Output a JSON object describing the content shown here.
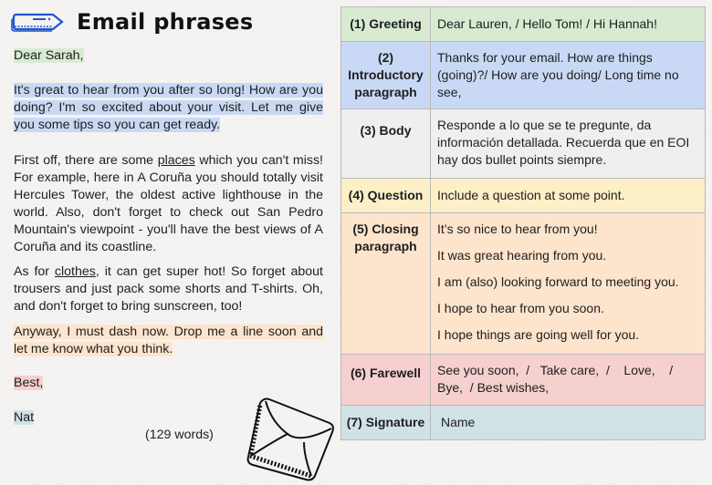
{
  "header": {
    "icon": "tag-label-icon",
    "title": "Email phrases"
  },
  "email": {
    "greeting": "Dear Sarah,",
    "intro": "It's great to hear from you after so long! How are you doing? I'm so excited about your visit. Let me give you some tips so you can get ready.",
    "body1_before": "First off, there are some ",
    "body1_link": "places",
    "body1_after": " which you can't miss! For example, here in A Coruña you should totally visit Hercules Tower, the oldest active lighthouse in the world. Also, don't forget to check out San Pedro Mountain's viewpoint - you'll have the best views of A Coruña and its coastline.",
    "body2_before": "As for ",
    "body2_link": "clothes",
    "body2_after": ", it can get super hot! So forget about trousers and just pack some shorts and T-shirts. Oh, and don't forget to bring sunscreen, too!",
    "closing": "Anyway, I must dash now. Drop me a line soon and let me know what you think.",
    "farewell": "Best,",
    "signature": "Nat",
    "word_count": "(129 words)"
  },
  "decoration": {
    "envelope_icon": "envelope-icon"
  },
  "table": {
    "rows": [
      {
        "label": "(1) Greeting",
        "content": "Dear Lauren,  / Hello Tom!  / Hi Hannah!",
        "color": "#d8ebd2"
      },
      {
        "label_lines": [
          "(2)",
          "Introductory",
          "paragraph"
        ],
        "content": "Thanks for your email. How are things (going)?/ How are you doing/ Long time no see,",
        "color": "#c9d9f5"
      },
      {
        "label": "(3) Body",
        "content": "Responde a lo que se te pregunte, da información detallada. Recuerda que en EOI hay dos bullet points siempre.",
        "color": "#efefef"
      },
      {
        "label": "(4) Question",
        "content": "Include a question at some point.",
        "color": "#fdefc8"
      },
      {
        "label_lines": [
          "(5) Closing",
          "paragraph"
        ],
        "content_items": [
          "It’s so nice to hear from you!",
          "It was great hearing from you.",
          "I am (also) looking forward to meeting you.",
          "I hope to hear from you soon.",
          "I hope things are going well for you."
        ],
        "color": "#fde4cc"
      },
      {
        "label": "(6) Farewell",
        "content_lines": [
          "See you soon,  /   Take care,  /    Love,    /",
          "Bye,  / Best wishes,"
        ],
        "color": "#f6cfcf"
      },
      {
        "label": "(7) Signature",
        "content": "Name",
        "color": "#d1e2e6"
      }
    ]
  }
}
